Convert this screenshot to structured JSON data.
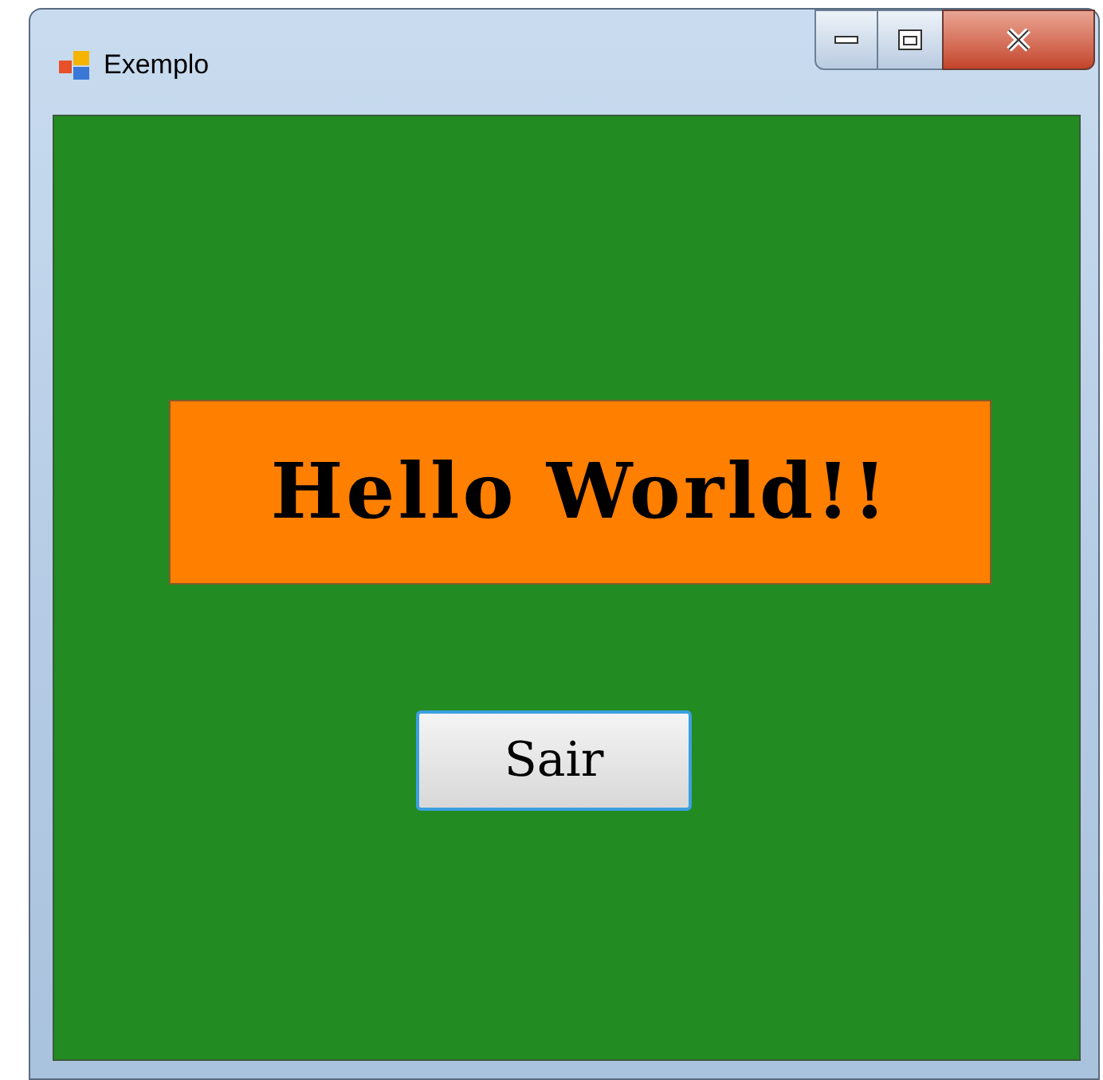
{
  "window": {
    "title": "Exemplo"
  },
  "label": {
    "text": "Hello World!!"
  },
  "button": {
    "label": "Sair"
  }
}
